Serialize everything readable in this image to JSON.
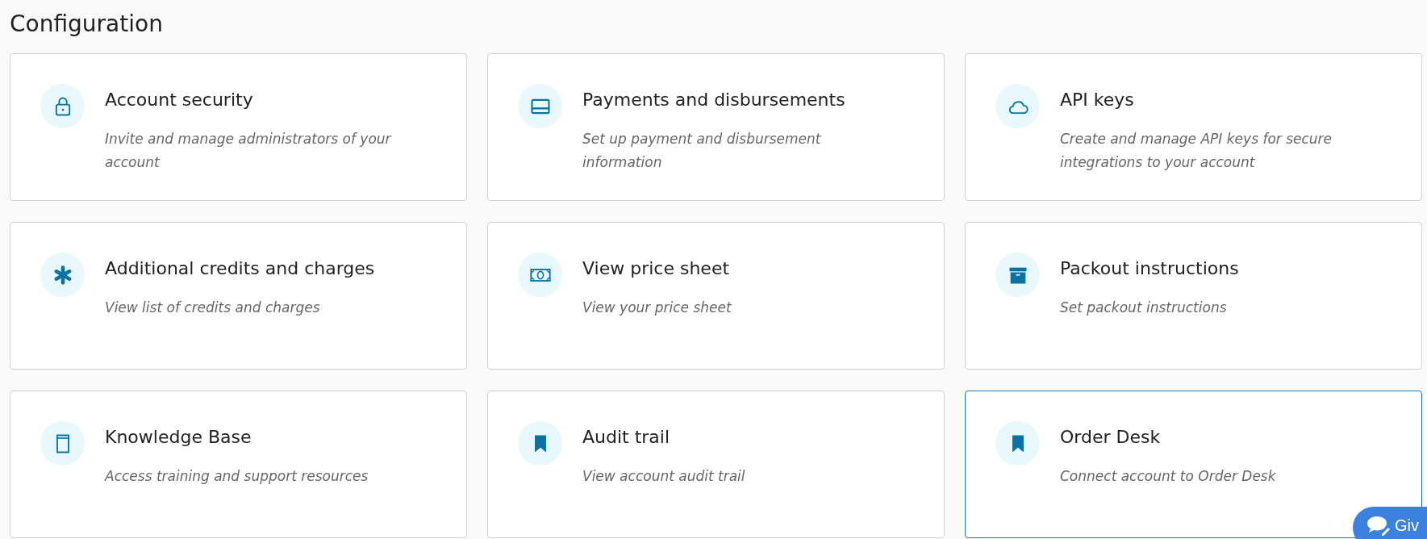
{
  "page_title": "Configuration",
  "cards": [
    {
      "kind": "lock",
      "title": "Account security",
      "description": "Invite and manage administrators of your account",
      "highlighted": false
    },
    {
      "kind": "card",
      "title": "Payments and disbursements",
      "description": "Set up payment and disbursement information",
      "highlighted": false
    },
    {
      "kind": "cloud",
      "title": "API keys",
      "description": "Create and manage API keys for secure integrations to your account",
      "highlighted": false
    },
    {
      "kind": "asterisk",
      "title": "Additional credits and charges",
      "description": "View list of credits and charges",
      "highlighted": false
    },
    {
      "kind": "money",
      "title": "View price sheet",
      "description": "View your price sheet",
      "highlighted": false
    },
    {
      "kind": "box",
      "title": "Packout instructions",
      "description": "Set packout instructions",
      "highlighted": false
    },
    {
      "kind": "book",
      "title": "Knowledge Base",
      "description": "Access training and support resources",
      "highlighted": false
    },
    {
      "kind": "bookmark",
      "title": "Audit trail",
      "description": "View account audit trail",
      "highlighted": false
    },
    {
      "kind": "bookmark",
      "title": "Order Desk",
      "description": "Connect account to Order Desk",
      "highlighted": true
    }
  ],
  "feedback_button": {
    "label": "Giv"
  }
}
